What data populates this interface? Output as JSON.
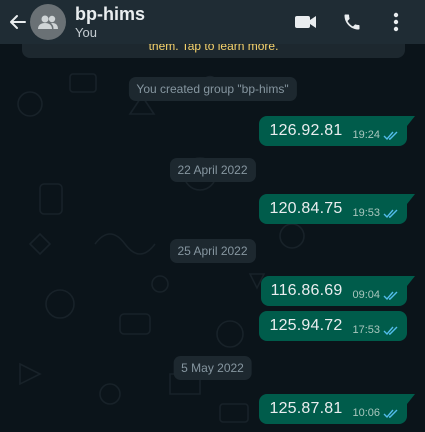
{
  "header": {
    "title": "bp-hims",
    "subtitle": "You",
    "icons": [
      "back-arrow-icon",
      "group-avatar-icon",
      "video-call-icon",
      "phone-icon",
      "more-icon"
    ]
  },
  "chat": {
    "encryption_banner": "them. Tap to learn more.",
    "system_message": "You created group \"bp-hims\"",
    "date_chips": [
      "22 April 2022",
      "25 April 2022",
      "5 May 2022"
    ],
    "messages": [
      {
        "text": "126.92.81",
        "time": "19:24",
        "status": "read"
      },
      {
        "text": "120.84.75",
        "time": "19:53",
        "status": "read"
      },
      {
        "text": "116.86.69",
        "time": "09:04",
        "status": "read"
      },
      {
        "text": "125.94.72",
        "time": "17:53",
        "status": "read"
      },
      {
        "text": "125.87.81",
        "time": "10:06",
        "status": "read"
      }
    ]
  },
  "colors": {
    "header_bg": "#1f2c34",
    "chat_bg": "#0b141a",
    "outgoing_bubble": "#005c4b",
    "read_ticks": "#53bdeb",
    "system_chip": "#1d282f"
  }
}
